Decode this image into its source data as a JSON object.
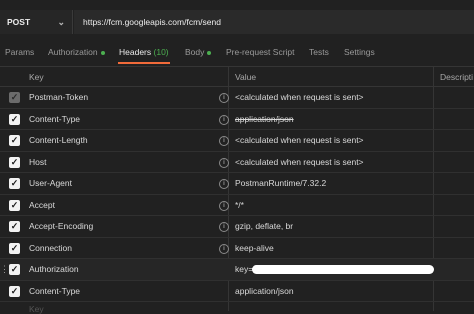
{
  "request": {
    "method": "POST",
    "url": "https://fcm.googleapis.com/fcm/send"
  },
  "tabs": [
    {
      "label": "Params"
    },
    {
      "label": "Authorization",
      "dot": true
    },
    {
      "label": "Headers",
      "count": "(10)",
      "active": true
    },
    {
      "label": "Body",
      "dot": true
    },
    {
      "label": "Pre-request Script"
    },
    {
      "label": "Tests"
    },
    {
      "label": "Settings"
    }
  ],
  "table": {
    "columns": {
      "key": "Key",
      "value": "Value",
      "description": "Descripti"
    },
    "rows": [
      {
        "key": "Postman-Token",
        "value": "<calculated when request is sent>",
        "info": true,
        "checked": true,
        "disabled": true
      },
      {
        "key": "Content-Type",
        "value": "application/json",
        "info": true,
        "checked": true,
        "strike": true
      },
      {
        "key": "Content-Length",
        "value": "<calculated when request is sent>",
        "info": true,
        "checked": true
      },
      {
        "key": "Host",
        "value": "<calculated when request is sent>",
        "info": true,
        "checked": true
      },
      {
        "key": "User-Agent",
        "value": "PostmanRuntime/7.32.2",
        "info": true,
        "checked": true
      },
      {
        "key": "Accept",
        "value": "*/*",
        "info": true,
        "checked": true
      },
      {
        "key": "Accept-Encoding",
        "value": "gzip, deflate, br",
        "info": true,
        "checked": true
      },
      {
        "key": "Connection",
        "value": "keep-alive",
        "info": true,
        "checked": true
      },
      {
        "key": "Authorization",
        "value": "key=",
        "checked": true,
        "redacted": true,
        "drag": true
      },
      {
        "key": "Content-Type",
        "value": "application/json",
        "checked": true
      }
    ],
    "placeholder_key": "Key"
  },
  "icons": {
    "checkbox": "check-icon",
    "info": "info-icon",
    "method_dropdown": "chevron-down-icon",
    "drag": "drag-handle-icon"
  },
  "colors": {
    "accent": "#f26b3a",
    "dot": "#4caf50",
    "background": "#212121"
  }
}
